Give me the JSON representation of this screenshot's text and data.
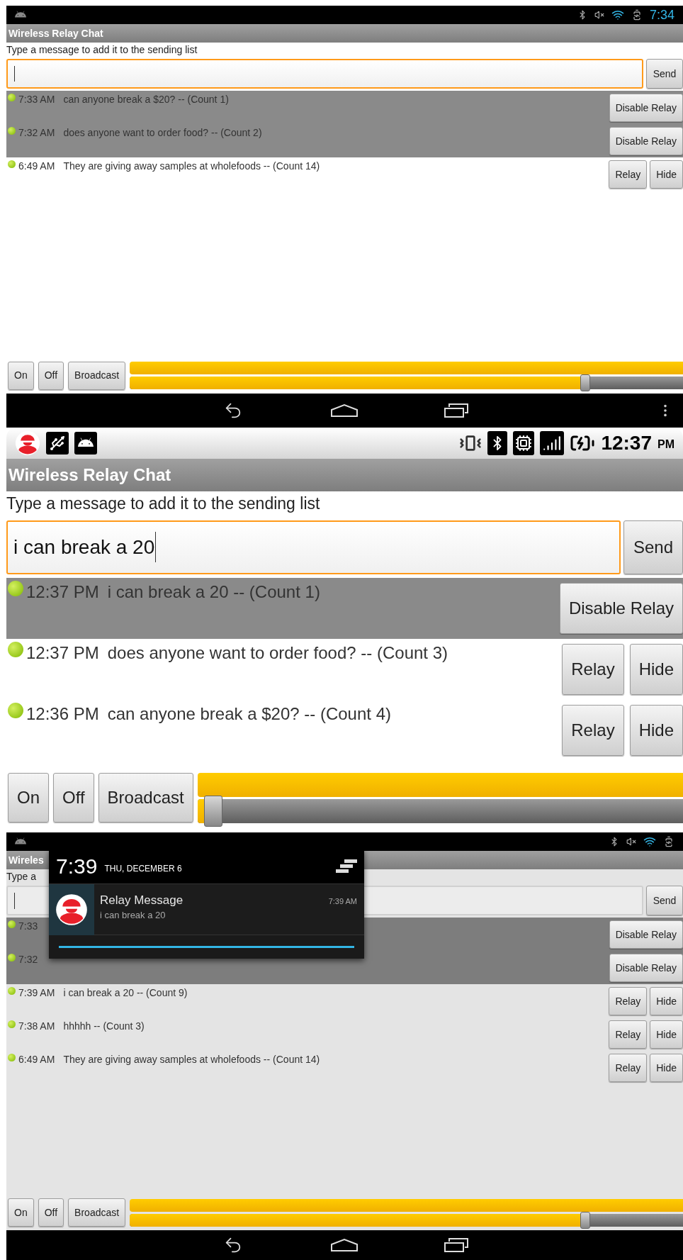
{
  "screens": [
    {
      "kind": "small",
      "status_bar": {
        "time": "7:34"
      },
      "title": "Wireless Relay Chat",
      "prompt": "Type a message to add it to the sending list",
      "send": "Send",
      "messages": [
        {
          "time": "7:33 AM",
          "text": "can anyone break a $20? -- (Count 1)",
          "relaying": true,
          "actions": [
            "Disable Relay"
          ]
        },
        {
          "time": "7:32 AM",
          "text": "does anyone want to order food? -- (Count 2)",
          "relaying": true,
          "actions": [
            "Disable Relay"
          ]
        },
        {
          "time": "6:49 AM",
          "text": "They are giving away samples at wholefoods -- (Count 14)",
          "relaying": false,
          "actions": [
            "Relay",
            "Hide"
          ]
        }
      ],
      "controls": {
        "buttons": [
          "On",
          "Off",
          "Broadcast"
        ],
        "progress": {
          "level": 1
        },
        "slider": {
          "level": 0.82
        }
      },
      "nav_bar": {
        "menu": true
      }
    },
    {
      "kind": "large",
      "status_bar": {
        "time": "12:37",
        "period": "PM"
      },
      "title": "Wireless Relay Chat",
      "prompt": "Type a message to add it to the sending list",
      "input": {
        "value": "i can break a 20"
      },
      "send": "Send",
      "messages": [
        {
          "time": "12:37 PM",
          "text": "i can break a 20 -- (Count 1)",
          "relaying": true,
          "actions": [
            "Disable Relay"
          ]
        },
        {
          "time": "12:37 PM",
          "text": "does anyone want to order food? -- (Count 3)",
          "relaying": false,
          "actions": [
            "Relay",
            "Hide"
          ]
        },
        {
          "time": "12:36 PM",
          "text": "can anyone break a $20? -- (Count 4)",
          "relaying": false,
          "actions": [
            "Relay",
            "Hide"
          ]
        }
      ],
      "controls": {
        "buttons": [
          "On",
          "Off",
          "Broadcast"
        ],
        "progress": {
          "level": 1
        },
        "slider": {
          "level": 0.02
        }
      }
    },
    {
      "kind": "small",
      "title": "Wireles",
      "prompt": "Type a",
      "send": "Send",
      "notification": {
        "clock": "7:39",
        "date": "THU, DECEMBER 6",
        "title": "Relay Message",
        "text": "i can break a 20",
        "time": "7:39 AM"
      },
      "messages": [
        {
          "time": "7:33",
          "relaying": true,
          "actions": [
            "Disable Relay"
          ]
        },
        {
          "time": "7:32",
          "relaying": true,
          "actions": [
            "Disable Relay"
          ]
        },
        {
          "time": "7:39 AM",
          "text": "i can break a 20 -- (Count 9)",
          "relaying": false,
          "actions": [
            "Relay",
            "Hide"
          ]
        },
        {
          "time": "7:38 AM",
          "text": "hhhhh -- (Count 3)",
          "relaying": false,
          "actions": [
            "Relay",
            "Hide"
          ]
        },
        {
          "time": "6:49 AM",
          "text": "They are giving away samples at wholefoods -- (Count 14)",
          "relaying": false,
          "actions": [
            "Relay",
            "Hide"
          ]
        }
      ],
      "controls": {
        "buttons": [
          "On",
          "Off",
          "Broadcast"
        ],
        "progress": {
          "level": 1
        },
        "slider": {
          "level": 0.82
        }
      },
      "nav_bar": {
        "menu": false
      }
    }
  ]
}
